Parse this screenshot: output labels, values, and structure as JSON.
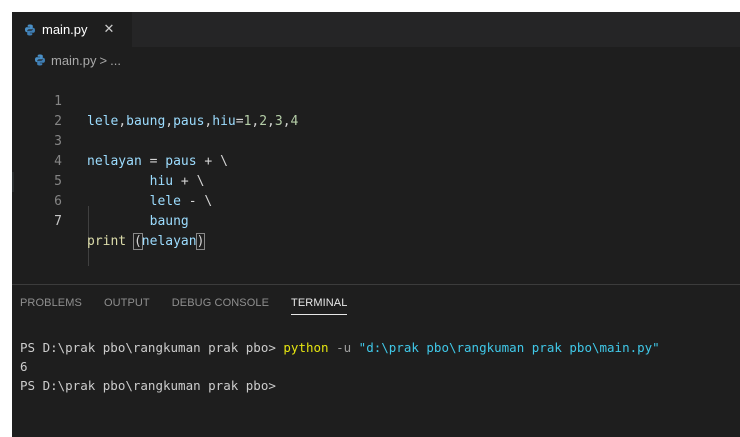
{
  "tab": {
    "label": "main.py",
    "close": "✕",
    "icon": "python-file-icon"
  },
  "breadcrumb": {
    "file": "main.py",
    "separator": ">",
    "ellipsis": "..."
  },
  "editor": {
    "line_numbers": [
      "1",
      "2",
      "3",
      "4",
      "5",
      "6",
      "7"
    ],
    "active_line": 7,
    "lines": [
      [
        "lele",
        ",",
        "baung",
        ",",
        "paus",
        ",",
        "hiu",
        "=",
        "1",
        ",",
        "2",
        ",",
        "3",
        ",",
        "4"
      ],
      [],
      [
        "nelayan",
        " = ",
        "paus",
        " + \\"
      ],
      [
        "        ",
        "hiu",
        " + \\"
      ],
      [
        "        ",
        "lele",
        " - \\"
      ],
      [
        "        ",
        "baung"
      ],
      [
        "print",
        " ",
        "(",
        "nelayan",
        ")"
      ]
    ]
  },
  "panel": {
    "tabs": [
      "PROBLEMS",
      "OUTPUT",
      "DEBUG CONSOLE",
      "TERMINAL"
    ],
    "active_tab": "TERMINAL"
  },
  "terminal": {
    "prompt1": "PS D:\\prak pbo\\rangkuman prak pbo> ",
    "command": "python",
    "flag": " -u ",
    "arg": "\"d:\\prak pbo\\rangkuman prak pbo\\main.py\"",
    "output": "6",
    "prompt2": "PS D:\\prak pbo\\rangkuman prak pbo>"
  },
  "colors": {
    "background": "#1e1e1e",
    "tabbar": "#252526",
    "variable": "#9cdcfe",
    "function": "#dcdcaa",
    "number": "#b5cea8",
    "terminal_command": "#e5e510",
    "terminal_string": "#40c8e8"
  }
}
